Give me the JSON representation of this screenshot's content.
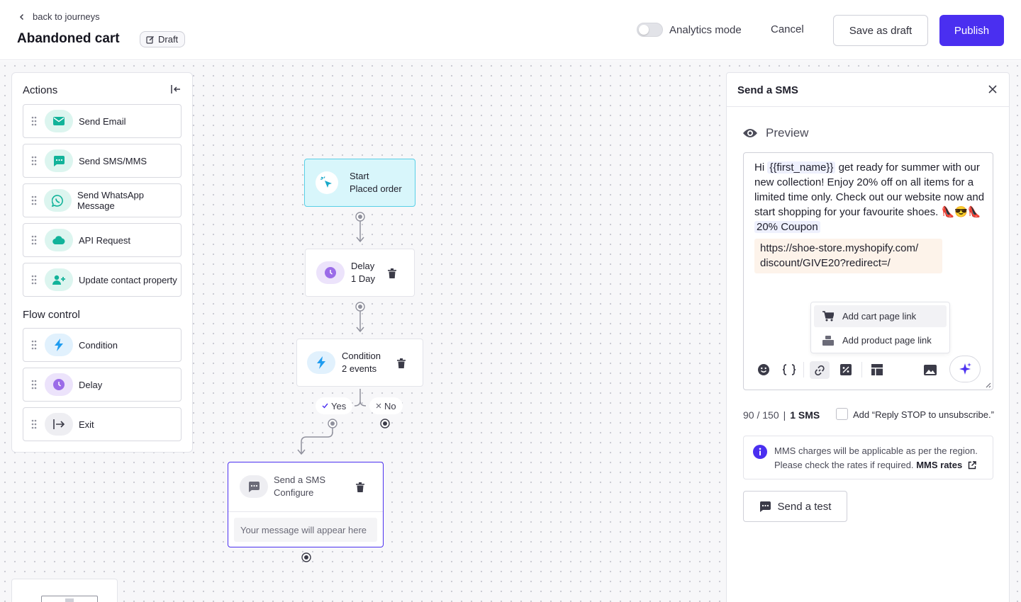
{
  "header": {
    "back_label": "back to journeys",
    "title": "Abandoned cart",
    "draft_label": "Draft",
    "analytics_label": "Analytics mode",
    "cancel_label": "Cancel",
    "save_draft_label": "Save as draft",
    "publish_label": "Publish"
  },
  "actions_panel": {
    "heading": "Actions",
    "items": [
      {
        "label": "Send Email",
        "icon": "mail-icon"
      },
      {
        "label": "Send SMS/MMS",
        "icon": "sms-icon"
      },
      {
        "label": "Send WhatsApp Message",
        "icon": "whatsapp-icon"
      },
      {
        "label": "API Request",
        "icon": "cloud-icon"
      },
      {
        "label": "Update contact property",
        "icon": "user-plus-icon"
      }
    ],
    "flow_heading": "Flow control",
    "flow_items": [
      {
        "label": "Condition",
        "icon": "lightning-icon"
      },
      {
        "label": "Delay",
        "icon": "clock-icon"
      },
      {
        "label": "Exit",
        "icon": "exit-icon"
      }
    ]
  },
  "nodes": {
    "start": {
      "title": "Start",
      "subtitle": "Placed order"
    },
    "delay": {
      "title": "Delay",
      "subtitle": "1 Day"
    },
    "condition": {
      "title": "Condition",
      "subtitle": "2 events"
    },
    "yes_label": "Yes",
    "no_label": "No",
    "sms": {
      "title": "Send a SMS",
      "subtitle": "Configure",
      "placeholder": "Your message will appear here"
    }
  },
  "sms_panel": {
    "title": "Send a SMS",
    "preview_label": "Preview",
    "message_prefix": "Hi",
    "token": "{{first_name}}",
    "message_body": "get ready for summer with our new collection! Enjoy 20% off on all items for a limited time only. Check out our website now and start shopping for your favourite shoes.",
    "emoji": "👠😎👠",
    "coupon": "20% Coupon",
    "url_line1": "https://shoe-store.myshopify.com/",
    "url_line2": "discount/GIVE20?redirect=/",
    "dropdown": [
      "Add cart page link",
      "Add product page link"
    ],
    "char_count": "90 / 150",
    "sms_count": "1 SMS",
    "stop_label": "Add “Reply STOP to unsubscribe.”",
    "info_line1": "MMS charges will be applicable as per the region.",
    "info_line2": "Please check the rates if required.",
    "info_link": "MMS rates",
    "send_test_label": "Send a test"
  },
  "colors": {
    "accent": "#4a2ff0",
    "teal": "#12b39a",
    "start_bg": "#d8f6fb",
    "start_border": "#58cfe6",
    "lightning": "#1f9cf0",
    "clock": "#9b6ce8"
  }
}
